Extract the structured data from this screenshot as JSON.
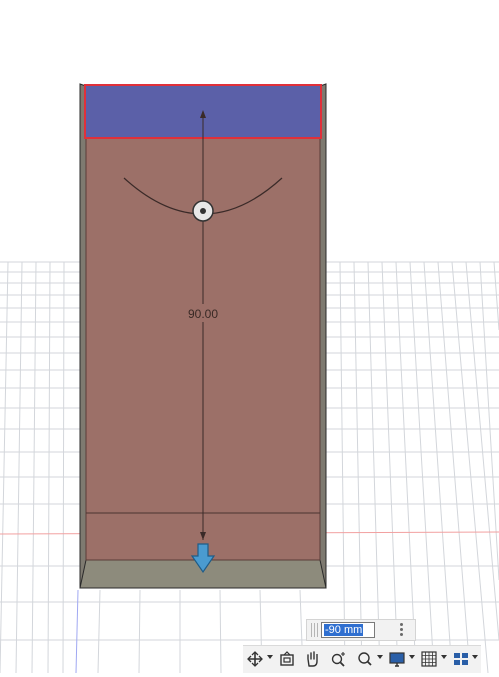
{
  "model": {
    "dimension_label": "90.00"
  },
  "dimension_input": {
    "value": "-90 mm"
  },
  "colors": {
    "face_body": "#9c7068",
    "face_selected": "#5b60a8",
    "selection_outline": "#e0303a",
    "bottom_face": "#8d8b7c",
    "grid_line": "#d3d6db",
    "axis_red": "#f2a0a0",
    "axis_blue": "#a0a8f2",
    "arrow": "#4a9bd0"
  },
  "navigation_toolbar": {
    "items": [
      {
        "icon": "orbit-icon",
        "has_menu": true
      },
      {
        "icon": "look-at-icon",
        "has_menu": false
      },
      {
        "icon": "pan-hand-icon",
        "has_menu": false
      },
      {
        "icon": "zoom-icon",
        "has_menu": false
      },
      {
        "icon": "fit-icon",
        "has_menu": true
      },
      {
        "icon": "display-settings-icon",
        "has_menu": true
      },
      {
        "icon": "grid-snaps-icon",
        "has_menu": true
      },
      {
        "icon": "viewports-icon",
        "has_menu": true
      }
    ]
  }
}
